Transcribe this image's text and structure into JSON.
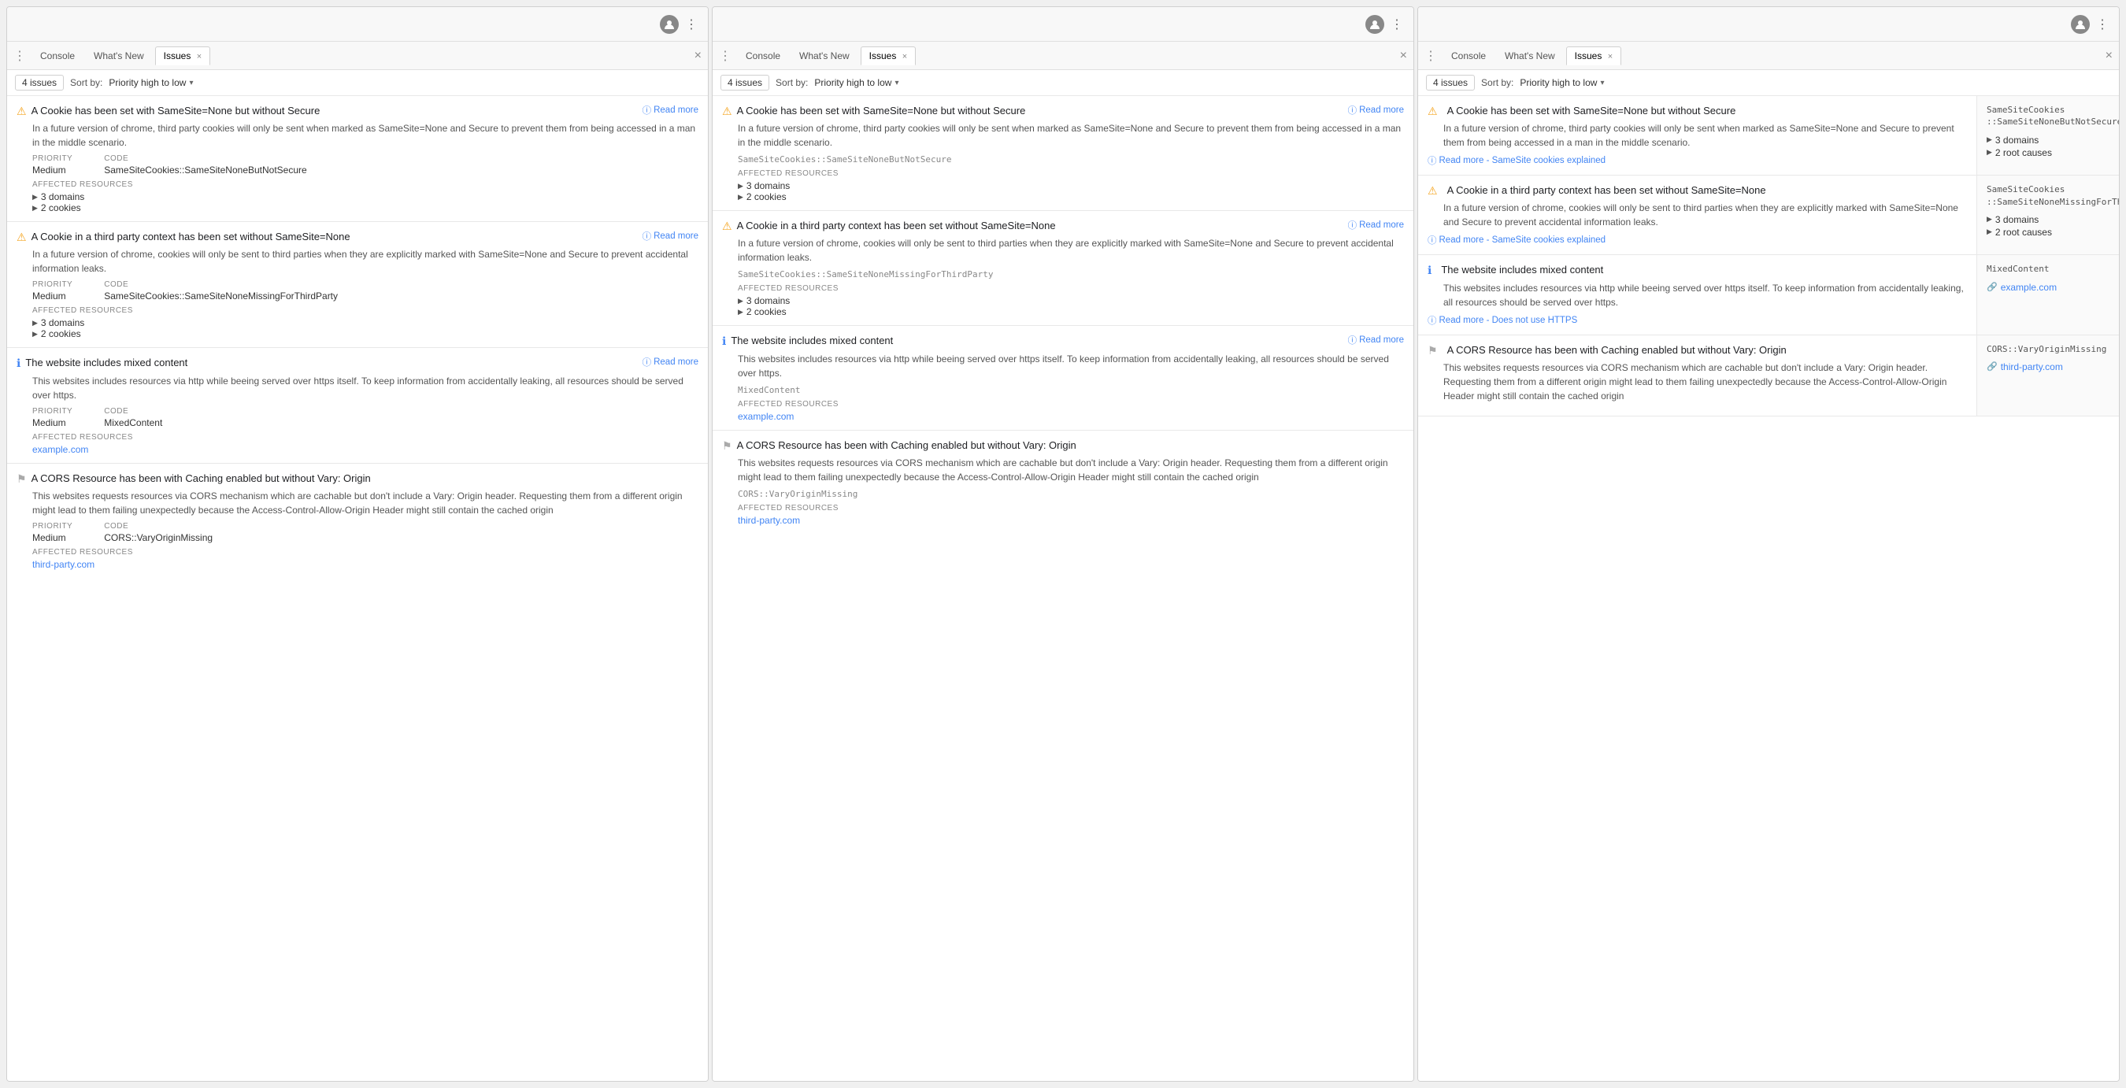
{
  "panels": [
    {
      "id": "panel-left",
      "topbar": {
        "avatar": "👤",
        "dots": "⋮"
      },
      "tabs": [
        {
          "id": "console",
          "label": "Console",
          "active": false,
          "closable": false
        },
        {
          "id": "whatsnew",
          "label": "What's New",
          "active": false,
          "closable": false
        },
        {
          "id": "issues",
          "label": "Issues",
          "active": true,
          "closable": true
        }
      ],
      "toolbar": {
        "count": "4 issues",
        "sort_label": "Sort by:",
        "sort_value": "Priority high to low"
      },
      "issues": [
        {
          "id": "issue-1",
          "icon": "warn",
          "title": "A Cookie has been set with SameSite=None but without Secure",
          "read_more": "Read more",
          "description": "In a future version of chrome, third party cookies will only be sent when marked as SameSite=None and Secure to prevent them from being accessed in a man in the middle scenario.",
          "priority_label": "PRIORITY",
          "priority_value": "Medium",
          "code_label": "CODE",
          "code_value": "SameSiteCookies::SameSiteNoneButNotSecure",
          "affected_label": "AFFECTED RESOURCES",
          "affected": [
            "3 domains",
            "2 cookies"
          ],
          "link": null
        },
        {
          "id": "issue-2",
          "icon": "warn",
          "title": "A Cookie in a third party context has been set without SameSite=None",
          "read_more": "Read more",
          "description": "In a future version of chrome, cookies will only be sent to third parties when they are explicitly marked with SameSite=None and Secure to prevent accidental information leaks.",
          "priority_label": "PRIORITY",
          "priority_value": "Medium",
          "code_label": "CODE",
          "code_value": "SameSiteCookies::SameSiteNoneMissingForThirdParty",
          "affected_label": "AFFECTED RESOURCES",
          "affected": [
            "3 domains",
            "2 cookies"
          ],
          "link": null
        },
        {
          "id": "issue-3",
          "icon": "info",
          "title": "The website includes mixed content",
          "read_more": "Read more",
          "description": "This websites includes resources via http while beeing served over https itself. To keep information from accidentally leaking, all resources should be served over https.",
          "priority_label": "PRIORITY",
          "priority_value": "Medium",
          "code_label": "CODE",
          "code_value": "MixedContent",
          "affected_label": "AFFECTED RESOURCES",
          "affected": [],
          "link": "example.com"
        },
        {
          "id": "issue-4",
          "icon": "flag",
          "title": "A CORS Resource has been with Caching enabled but without Vary: Origin",
          "read_more": null,
          "description": "This websites requests resources via CORS mechanism which are cachable but don't include a Vary: Origin header. Requesting them from a different origin might lead to them failing unexpectedly because the Access-Control-Allow-Origin Header might still contain the cached origin",
          "priority_label": "PRIORITY",
          "priority_value": "Medium",
          "code_label": "CODE",
          "code_value": "CORS::VaryOriginMissing",
          "affected_label": "AFFECTED RESOURCES",
          "affected": [],
          "link": "third-party.com"
        }
      ]
    },
    {
      "id": "panel-middle",
      "topbar": {
        "avatar": "👤",
        "dots": "⋮"
      },
      "tabs": [
        {
          "id": "console",
          "label": "Console",
          "active": false,
          "closable": false
        },
        {
          "id": "whatsnew",
          "label": "What's New",
          "active": false,
          "closable": false
        },
        {
          "id": "issues",
          "label": "Issues",
          "active": true,
          "closable": true
        }
      ],
      "toolbar": {
        "count": "4 issues",
        "sort_label": "Sort by:",
        "sort_value": "Priority high to low"
      },
      "issues": [
        {
          "id": "issue-1",
          "icon": "warn",
          "title": "A Cookie has been set with SameSite=None but without Secure",
          "read_more": "Read more",
          "description": "In a future version of chrome, third party cookies will only be sent when marked as SameSite=None and Secure to prevent them from being accessed in a man in the middle scenario.",
          "code_value": "SameSiteCookies::SameSiteNoneButNotSecure",
          "affected_label": "AFFECTED RESOURCES",
          "affected": [
            "3 domains",
            "2 cookies"
          ],
          "link": null
        },
        {
          "id": "issue-2",
          "icon": "warn",
          "title": "A Cookie in a third party context has been set without SameSite=None",
          "read_more": "Read more",
          "description": "In a future version of chrome, cookies will only be sent to third parties when they are explicitly marked with SameSite=None and Secure to prevent accidental information leaks.",
          "code_value": "SameSiteCookies::SameSiteNoneMissingForThirdParty",
          "affected_label": "AFFECTED RESOURCES",
          "affected": [
            "3 domains",
            "2 cookies"
          ],
          "link": null
        },
        {
          "id": "issue-3",
          "icon": "info",
          "title": "The website includes mixed content",
          "read_more": "Read more",
          "description": "This websites includes resources via http while beeing served over https itself. To keep information from accidentally leaking, all resources should be served over https.",
          "code_value": "MixedContent",
          "affected_label": "AFFECTED RESOURCES",
          "affected": [],
          "link": "example.com"
        },
        {
          "id": "issue-4",
          "icon": "flag",
          "title": "A CORS Resource has been with Caching enabled but without Vary: Origin",
          "read_more": null,
          "description": "This websites requests resources via CORS mechanism which are cachable but don't include a Vary: Origin header. Requesting them from a different origin might lead to them failing unexpectedly because the Access-Control-Allow-Origin Header might still contain the cached origin",
          "code_value": "CORS::VaryOriginMissing",
          "affected_label": "AFFECTED RESOURCES",
          "affected": [],
          "link": "third-party.com"
        }
      ]
    },
    {
      "id": "panel-right",
      "topbar": {
        "avatar": "👤",
        "dots": "⋮"
      },
      "tabs": [
        {
          "id": "console",
          "label": "Console",
          "active": false,
          "closable": false
        },
        {
          "id": "whatsnew",
          "label": "What's New",
          "active": false,
          "closable": false
        },
        {
          "id": "issues",
          "label": "Issues",
          "active": true,
          "closable": true
        }
      ],
      "toolbar": {
        "count": "4 issues",
        "sort_label": "Sort by:",
        "sort_value": "Priority high to low"
      },
      "issues": [
        {
          "id": "issue-1",
          "icon": "warn",
          "title": "A Cookie has been set with SameSite=None but without Secure",
          "description": "In a future version of chrome, third party cookies will only be sent when marked as SameSite=None and Secure to prevent them from being accessed in a man in the middle scenario.",
          "read_more": "Read more - SameSite cookies explained",
          "sidebar_code": "SameSiteCookies\n::SameSiteNoneButNotSecure",
          "sidebar_stats": [
            "3 domains",
            "2 root causes"
          ]
        },
        {
          "id": "issue-2",
          "icon": "warn",
          "title": "A Cookie in a third party context has been set without SameSite=None",
          "description": "In a future version of chrome, cookies will only be sent to third parties when they are explicitly marked with SameSite=None and Secure to prevent accidental information leaks.",
          "read_more": "Read more - SameSite cookies explained",
          "sidebar_code": "SameSiteCookies\n::SameSiteNoneMissingForThirdParty",
          "sidebar_stats": [
            "3 domains",
            "2 root causes"
          ]
        },
        {
          "id": "issue-3",
          "icon": "info",
          "title": "The website includes mixed content",
          "description": "This websites includes resources via http while beeing served over https itself. To keep information from accidentally leaking, all resources should be served over https.",
          "read_more": "Read more - Does not use HTTPS",
          "sidebar_code": "MixedContent",
          "sidebar_stats": [],
          "sidebar_link": "example.com"
        },
        {
          "id": "issue-4",
          "icon": "flag",
          "title": "A CORS Resource has been with Caching enabled but without Vary: Origin",
          "description": "This websites requests resources via CORS mechanism which are cachable but don't include a Vary: Origin header. Requesting them from a different origin might lead to them failing unexpectedly because the Access-Control-Allow-Origin Header might still contain the cached origin",
          "read_more": null,
          "sidebar_code": "CORS::VaryOriginMissing",
          "sidebar_stats": [],
          "sidebar_link": "third-party.com"
        }
      ]
    }
  ],
  "icons": {
    "warn": "⚠",
    "info": "ℹ",
    "flag": "⚑",
    "close": "✕",
    "triangle": "▶",
    "chevron": "▾",
    "read_more_icon": "ⓘ",
    "link_icon": "🔗",
    "dots": "⋮"
  },
  "labels": {
    "priority": "PRIORITY",
    "code": "CODE",
    "affected": "AFFECTED RESOURCES",
    "sort_by": "Sort by:",
    "close_label": "×"
  }
}
